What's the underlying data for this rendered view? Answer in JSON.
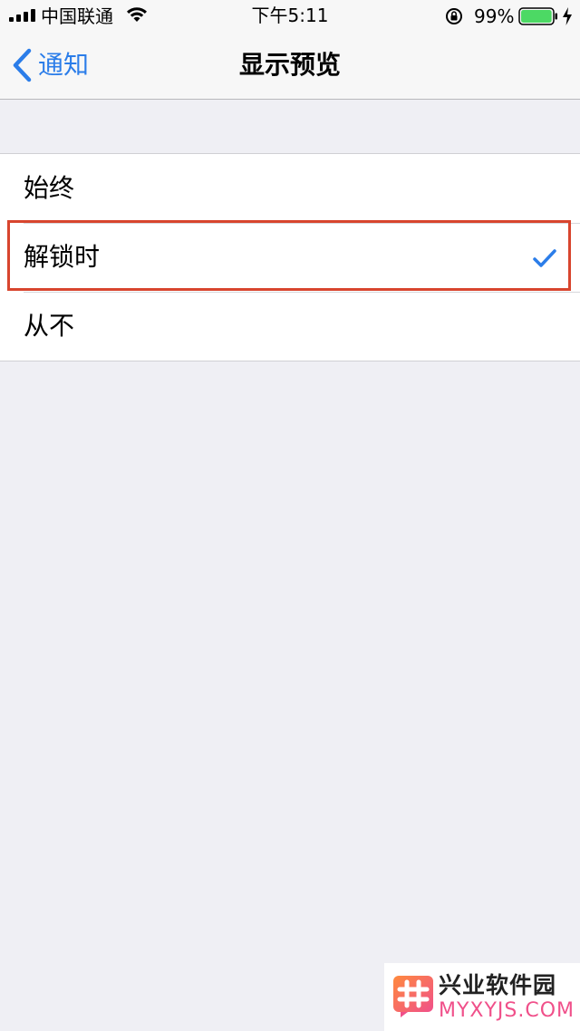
{
  "status_bar": {
    "carrier": "中国联通",
    "time": "下午5:11",
    "battery_percent": "99%",
    "battery_level": 0.99
  },
  "nav": {
    "back_label": "通知",
    "title": "显示预览"
  },
  "options": [
    {
      "label": "始终",
      "selected": false
    },
    {
      "label": "解锁时",
      "selected": true
    },
    {
      "label": "从不",
      "selected": false
    }
  ],
  "watermark": {
    "title": "兴业软件园",
    "url": "MYXYJS.COM"
  },
  "colors": {
    "accent": "#2b7de9",
    "highlight_border": "#d8452e",
    "battery_green": "#4cd964",
    "background": "#efeff4"
  }
}
